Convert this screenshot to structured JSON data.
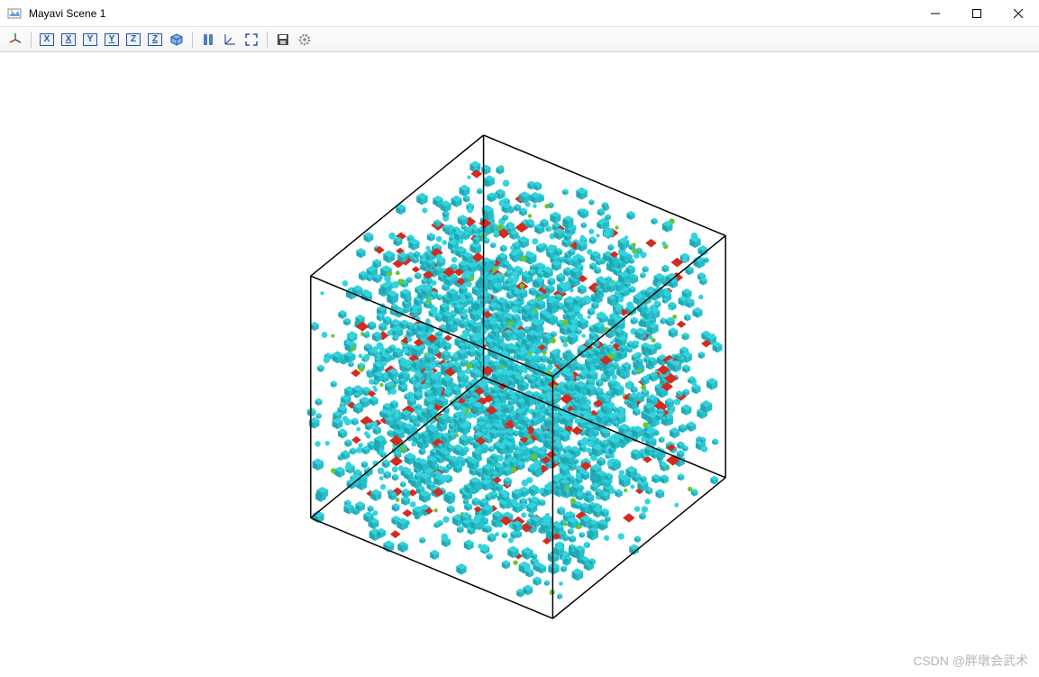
{
  "window": {
    "title": "Mayavi Scene 1",
    "controls": {
      "minimize": "–",
      "maximize": "☐",
      "close": "✕"
    }
  },
  "toolbar": {
    "items": [
      {
        "name": "view-interactive-icon",
        "label": "interactive"
      },
      {
        "name": "view-x-plus-icon",
        "letter": "X"
      },
      {
        "name": "view-x-minus-icon",
        "letter": "X"
      },
      {
        "name": "view-y-plus-icon",
        "letter": "Y"
      },
      {
        "name": "view-y-minus-icon",
        "letter": "Y"
      },
      {
        "name": "view-z-plus-icon",
        "letter": "Z"
      },
      {
        "name": "view-z-minus-icon",
        "letter": "Z"
      },
      {
        "name": "isometric-view-icon",
        "label": "iso"
      },
      {
        "name": "parallel-projection-icon",
        "label": "parallel"
      },
      {
        "name": "show-axes-icon",
        "label": "axes"
      },
      {
        "name": "fullscreen-icon",
        "label": "fullscreen"
      },
      {
        "name": "save-icon",
        "label": "save"
      },
      {
        "name": "configure-icon",
        "label": "configure"
      }
    ]
  },
  "scene": {
    "colors": {
      "cyan": "#33d3de",
      "cyan_dark": "#1fa8b3",
      "red": "#d42a1f",
      "green": "#6dc52c",
      "edge": "#000000"
    }
  },
  "watermark": "CSDN @胖墩会武术"
}
